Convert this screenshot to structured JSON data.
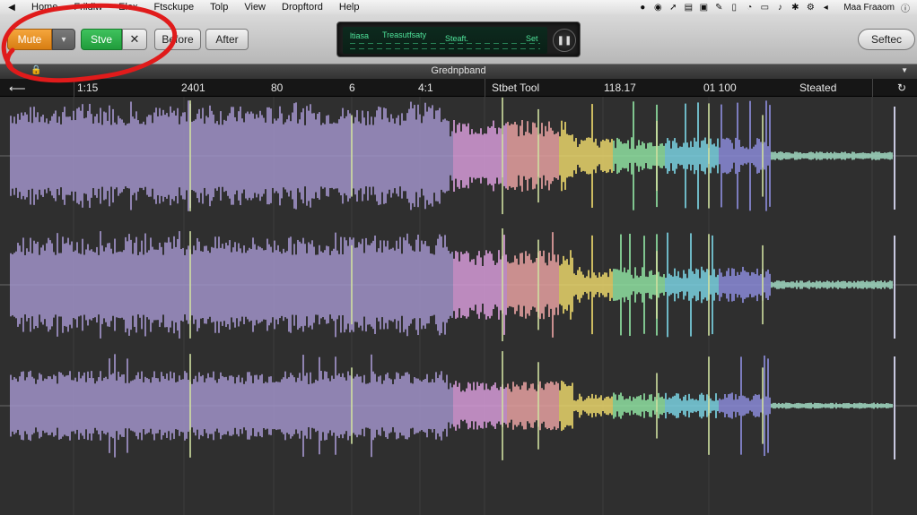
{
  "menubar": {
    "items": [
      "Home",
      "Frildiw",
      "Elex",
      "Ftsckupe",
      "Tolp",
      "View",
      "Dropftord",
      "Help"
    ],
    "user": "Maa Fraaom"
  },
  "toolbar": {
    "mute_label": "Mute",
    "save_label": "Stve",
    "before_label": "Before",
    "after_label": "After",
    "select_label": "Seftec",
    "lcd": {
      "line1": "ltiasa",
      "line2": "Treasutfsaty",
      "line3": "Steaft.",
      "line4": "Set"
    }
  },
  "title": "Grednpband",
  "ruler": {
    "labels": [
      "2401",
      "80",
      "6",
      "4:1",
      "Stbet Tool",
      "118.17",
      "01 100",
      "Steated"
    ],
    "start_label": "1:15"
  },
  "tracks": {
    "count": 3,
    "wave_base_color": "#a092c8",
    "spectrum_colors": [
      "#d59ad8",
      "#e6a0a0",
      "#e8d46a",
      "#8fe0a0",
      "#7ad0e0",
      "#8a8ad8"
    ]
  },
  "annotation_color": "#e01b1b"
}
